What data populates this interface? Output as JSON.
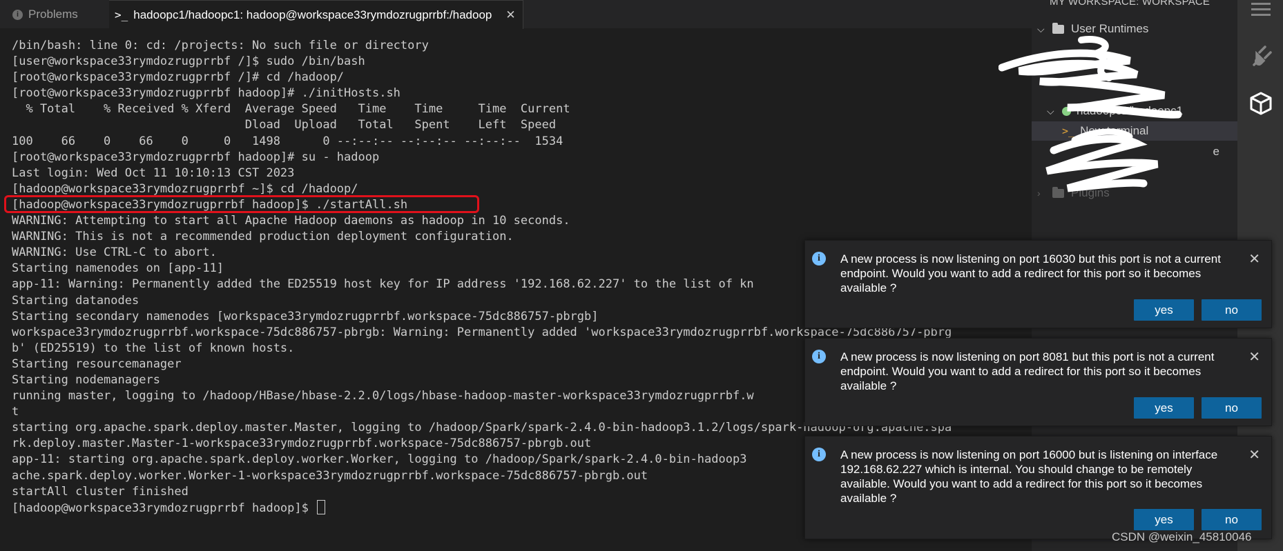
{
  "tabs": {
    "problems": "Problems",
    "terminal": "hadoopc1/hadoopc1: hadoop@workspace33rymdozrugprrbf:/hadoop"
  },
  "terminal": {
    "lines": [
      "/bin/bash: line 0: cd: /projects: No such file or directory",
      "[user@workspace33rymdozrugprrbf /]$ sudo /bin/bash",
      "[root@workspace33rymdozrugprrbf /]# cd /hadoop/",
      "[root@workspace33rymdozrugprrbf hadoop]# ./initHosts.sh",
      "  % Total    % Received % Xferd  Average Speed   Time    Time     Time  Current",
      "                                 Dload  Upload   Total   Spent    Left  Speed",
      "100    66    0    66    0     0   1498      0 --:--:-- --:--:-- --:--:--  1534",
      "[root@workspace33rymdozrugprrbf hadoop]# su - hadoop",
      "Last login: Wed Oct 11 10:10:13 CST 2023",
      "[hadoop@workspace33rymdozrugprrbf ~]$ cd /hadoop/",
      "[hadoop@workspace33rymdozrugprrbf hadoop]$ ./startAll.sh",
      "WARNING: Attempting to start all Apache Hadoop daemons as hadoop in 10 seconds.",
      "WARNING: This is not a recommended production deployment configuration.",
      "WARNING: Use CTRL-C to abort.",
      "Starting namenodes on [app-11]",
      "app-11: Warning: Permanently added the ED25519 host key for IP address '192.168.62.227' to the list of kn",
      "Starting datanodes",
      "Starting secondary namenodes [workspace33rymdozrugprrbf.workspace-75dc886757-pbrgb]",
      "workspace33rymdozrugprrbf.workspace-75dc886757-pbrgb: Warning: Permanently added 'workspace33rymdozrugprrbf.workspace-75dc886757-pbrg",
      "b' (ED25519) to the list of known hosts.",
      "Starting resourcemanager",
      "Starting nodemanagers",
      "running master, logging to /hadoop/HBase/hbase-2.2.0/logs/hbase-hadoop-master-workspace33rymdozrugprrbf.w",
      "t",
      "starting org.apache.spark.deploy.master.Master, logging to /hadoop/Spark/spark-2.4.0-bin-hadoop3.1.2/logs/spark-hadoop-org.apache.spa",
      "rk.deploy.master.Master-1-workspace33rymdozrugprrbf.workspace-75dc886757-pbrgb.out",
      "app-11: starting org.apache.spark.deploy.worker.Worker, logging to /hadoop/Spark/spark-2.4.0-bin-hadoop3",
      "ache.spark.deploy.worker.Worker-1-workspace33rymdozrugprrbf.workspace-75dc886757-pbrgb.out",
      "startAll cluster finished"
    ],
    "prompt": "[hadoop@workspace33rymdozrugprrbf hadoop]$ "
  },
  "sidebar": {
    "title": "MY WORKSPACE: WORKSPACE",
    "user_runtimes": "User Runtimes",
    "runtime_name": "hadoopc1/hadoopc1",
    "new_terminal": "New terminal",
    "partial_a": "e",
    "partial_b": "Plugins"
  },
  "notifications": [
    {
      "message": "A new process is now listening on port 16030 but this port is not a current endpoint. Would you want to add a redirect for this port so it becomes available ?",
      "yes": "yes",
      "no": "no"
    },
    {
      "message": "A new process is now listening on port 8081 but this port is not a current endpoint. Would you want to add a redirect for this port so it becomes available ?",
      "yes": "yes",
      "no": "no"
    },
    {
      "message": "A new process is now listening on port 16000 but is listening on interface 192.168.62.227 which is internal. You should change to be remotely available. Would you want to add a redirect for this port so it becomes available ?",
      "yes": "yes",
      "no": "no"
    }
  ],
  "watermark": "CSDN @weixin_45810046",
  "colors": {
    "highlight": "#e0111b",
    "button": "#0e639c",
    "info": "#75beff",
    "runtime_ok": "#89d185"
  }
}
